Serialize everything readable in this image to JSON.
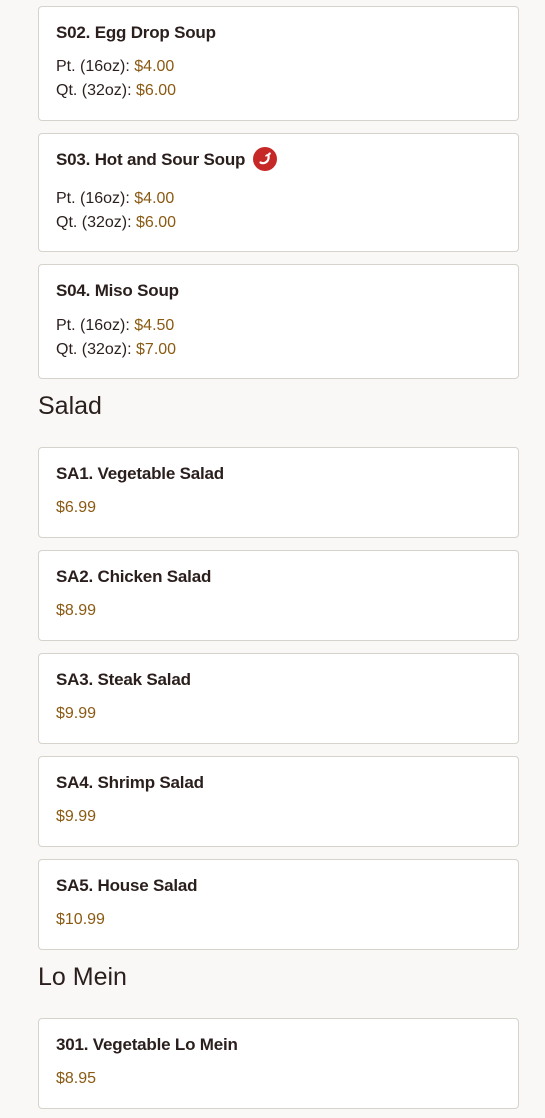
{
  "colors": {
    "price": "#8a5a13",
    "text": "#2a1f1d",
    "card_border": "#d6d2cc",
    "spicy_badge": "#c62828",
    "background": "#f9f8f6"
  },
  "soup_items": [
    {
      "name": "S02. Egg Drop Soup",
      "spicy": false,
      "prices": [
        {
          "label": "Pt. (16oz):",
          "price": "$4.00"
        },
        {
          "label": "Qt. (32oz):",
          "price": "$6.00"
        }
      ]
    },
    {
      "name": "S03. Hot and Sour Soup",
      "spicy": true,
      "spicy_icon": "chili-pepper-icon",
      "prices": [
        {
          "label": "Pt. (16oz):",
          "price": "$4.00"
        },
        {
          "label": "Qt. (32oz):",
          "price": "$6.00"
        }
      ]
    },
    {
      "name": "S04. Miso Soup",
      "spicy": false,
      "prices": [
        {
          "label": "Pt. (16oz):",
          "price": "$4.50"
        },
        {
          "label": "Qt. (32oz):",
          "price": "$7.00"
        }
      ]
    }
  ],
  "salad": {
    "title": "Salad",
    "items": [
      {
        "name": "SA1. Vegetable Salad",
        "price": "$6.99"
      },
      {
        "name": "SA2. Chicken Salad",
        "price": "$8.99"
      },
      {
        "name": "SA3. Steak Salad",
        "price": "$9.99"
      },
      {
        "name": "SA4. Shrimp Salad",
        "price": "$9.99"
      },
      {
        "name": "SA5. House Salad",
        "price": "$10.99"
      }
    ]
  },
  "lo_mein": {
    "title": "Lo Mein",
    "items": [
      {
        "name": "301. Vegetable Lo Mein",
        "price": "$8.95"
      }
    ]
  }
}
